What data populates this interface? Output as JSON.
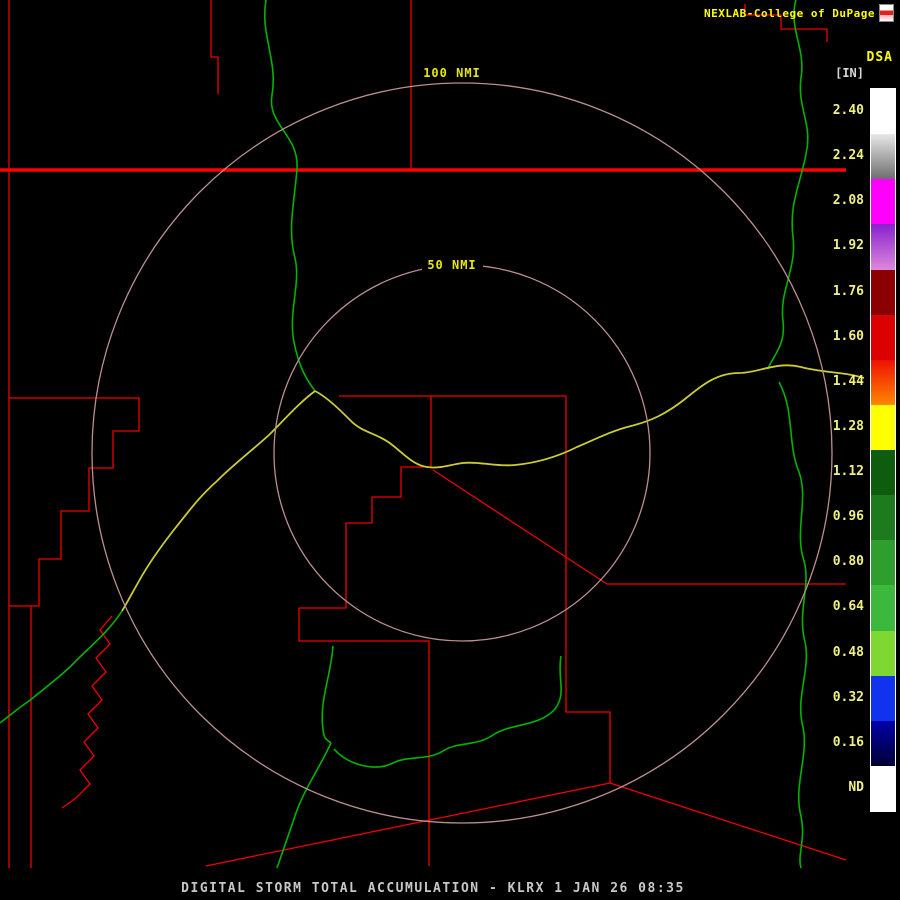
{
  "header": {
    "brand": "NEXLAB-College of DuPage"
  },
  "legend": {
    "product_code": "DSA",
    "units": "[IN]",
    "scale": [
      {
        "value": "2.40",
        "color_top": "#ffffff",
        "color_bottom": "#ffffff"
      },
      {
        "value": "2.24",
        "color_top": "#e8e8e8",
        "color_bottom": "#6e6e6e"
      },
      {
        "value": "2.08",
        "color_top": "#ff00ff",
        "color_bottom": "#ff00ff"
      },
      {
        "value": "1.92",
        "color_top": "#8822cc",
        "color_bottom": "#dd88dd"
      },
      {
        "value": "1.76",
        "color_top": "#8b0000",
        "color_bottom": "#8b0000"
      },
      {
        "value": "1.60",
        "color_top": "#dd0000",
        "color_bottom": "#dd0000"
      },
      {
        "value": "1.44",
        "color_top": "#ee1100",
        "color_bottom": "#ff8800"
      },
      {
        "value": "1.28",
        "color_top": "#ffff00",
        "color_bottom": "#ffff00"
      },
      {
        "value": "1.12",
        "color_top": "#0e5c0e",
        "color_bottom": "#0e5c0e"
      },
      {
        "value": "0.96",
        "color_top": "#1d7a1d",
        "color_bottom": "#1d7a1d"
      },
      {
        "value": "0.80",
        "color_top": "#2e9e2e",
        "color_bottom": "#2e9e2e"
      },
      {
        "value": "0.64",
        "color_top": "#3cb83c",
        "color_bottom": "#3cb83c"
      },
      {
        "value": "0.48",
        "color_top": "#7fd832",
        "color_bottom": "#7fd832"
      },
      {
        "value": "0.32",
        "color_top": "#1133ee",
        "color_bottom": "#1133ee"
      },
      {
        "value": "0.16",
        "color_top": "#0000aa",
        "color_bottom": "#000033"
      },
      {
        "value": "ND",
        "color_top": "#ffffff",
        "color_bottom": "#ffffff"
      }
    ]
  },
  "map": {
    "range_ring_labels": {
      "outer": "100 NMI",
      "inner": "50 NMI"
    },
    "colors": {
      "boundaries": "#ee0000",
      "state_line": "#ff0000",
      "rivers": "#00b400",
      "highlighted_river": "#cccc33",
      "range_rings": "#bc8f8f",
      "background": "#000000"
    }
  },
  "footer": {
    "title": "DIGITAL STORM TOTAL ACCUMULATION - KLRX 1 JAN 26 08:35"
  }
}
